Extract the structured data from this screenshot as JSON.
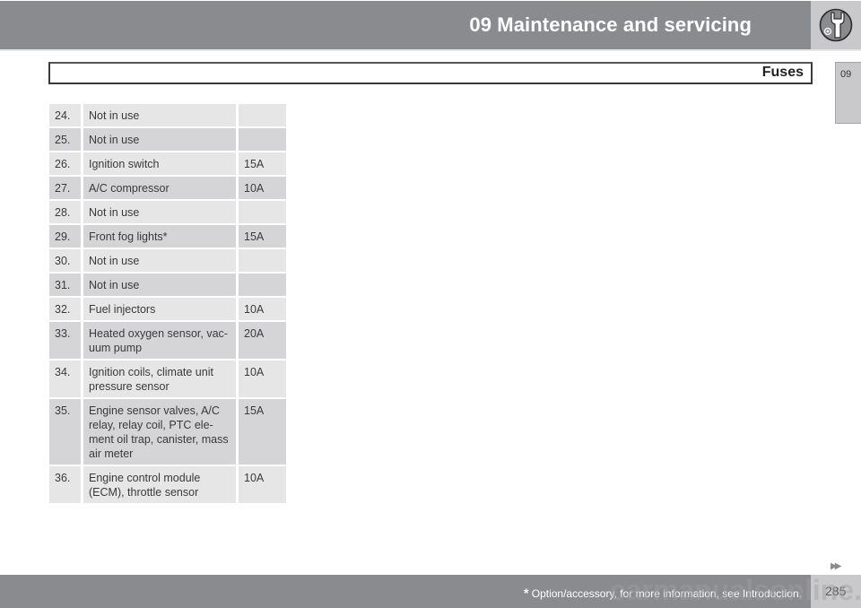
{
  "header": {
    "chapter_title": "09 Maintenance and servicing",
    "chapter_icon": "wrench-icon"
  },
  "section": {
    "title": "Fuses"
  },
  "chapter_tab": {
    "label": "09"
  },
  "fuse_table": {
    "rows": [
      {
        "num": "24.",
        "desc": "Not in use",
        "amp": "",
        "shade": "light"
      },
      {
        "num": "25.",
        "desc": "Not in use",
        "amp": "",
        "shade": "dark"
      },
      {
        "num": "26.",
        "desc": "Ignition switch",
        "amp": "15A",
        "shade": "light"
      },
      {
        "num": "27.",
        "desc": "A/C compressor",
        "amp": "10A",
        "shade": "dark"
      },
      {
        "num": "28.",
        "desc": "Not in use",
        "amp": "",
        "shade": "light"
      },
      {
        "num": "29.",
        "desc": "Front fog lights*",
        "amp": "15A",
        "shade": "dark"
      },
      {
        "num": "30.",
        "desc": "Not in use",
        "amp": "",
        "shade": "light"
      },
      {
        "num": "31.",
        "desc": "Not in use",
        "amp": "",
        "shade": "dark"
      },
      {
        "num": "32.",
        "desc": "Fuel injectors",
        "amp": "10A",
        "shade": "light"
      },
      {
        "num": "33.",
        "desc": "Heated oxygen sensor, vac-uum pump",
        "amp": "20A",
        "shade": "dark"
      },
      {
        "num": "34.",
        "desc": "Ignition coils, climate unit pressure sensor",
        "amp": "10A",
        "shade": "light"
      },
      {
        "num": "35.",
        "desc": "Engine sensor valves, A/C relay, relay coil, PTC ele-ment oil trap, canister, mass air meter",
        "amp": "15A",
        "shade": "dark"
      },
      {
        "num": "36.",
        "desc": "Engine control module (ECM), throttle sensor",
        "amp": "10A",
        "shade": "light"
      }
    ]
  },
  "navigation": {
    "next_page_icon": "double-chevron-right-icon",
    "next_glyph": "▶▶"
  },
  "footer": {
    "asterisk": "*",
    "note": " Option/accessory, for more information, see Introduction.",
    "page_number": "285"
  },
  "watermark": {
    "text": "carmanualsonline.info"
  }
}
